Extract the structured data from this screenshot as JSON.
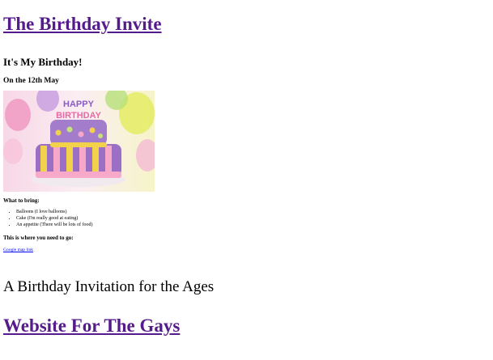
{
  "header": {
    "title": "The Birthday Invite"
  },
  "invite": {
    "heading": "It's My Birthday!",
    "date": "On the 12th May",
    "image": {
      "topper_line1": "HAPPY",
      "topper_line2": "BIRTHDAY"
    },
    "bring_heading": "What to bring:",
    "bring_items": [
      "Balloons (I love balloons)",
      "Cake (I'm really good at eating)",
      "An appetite (There will be lots of food)"
    ],
    "location_heading": "This is where you need to go:",
    "map_link": "Google map link"
  },
  "footer": {
    "tagline": "A Birthday Invitation for the Ages",
    "title": "Website For The Gays"
  },
  "colors": {
    "visited_link": "#551a8b",
    "link": "#0000ee",
    "cake_purple": "#9b6fc4",
    "cake_yellow": "#f2d24a",
    "cake_pink": "#f5a8c8"
  }
}
